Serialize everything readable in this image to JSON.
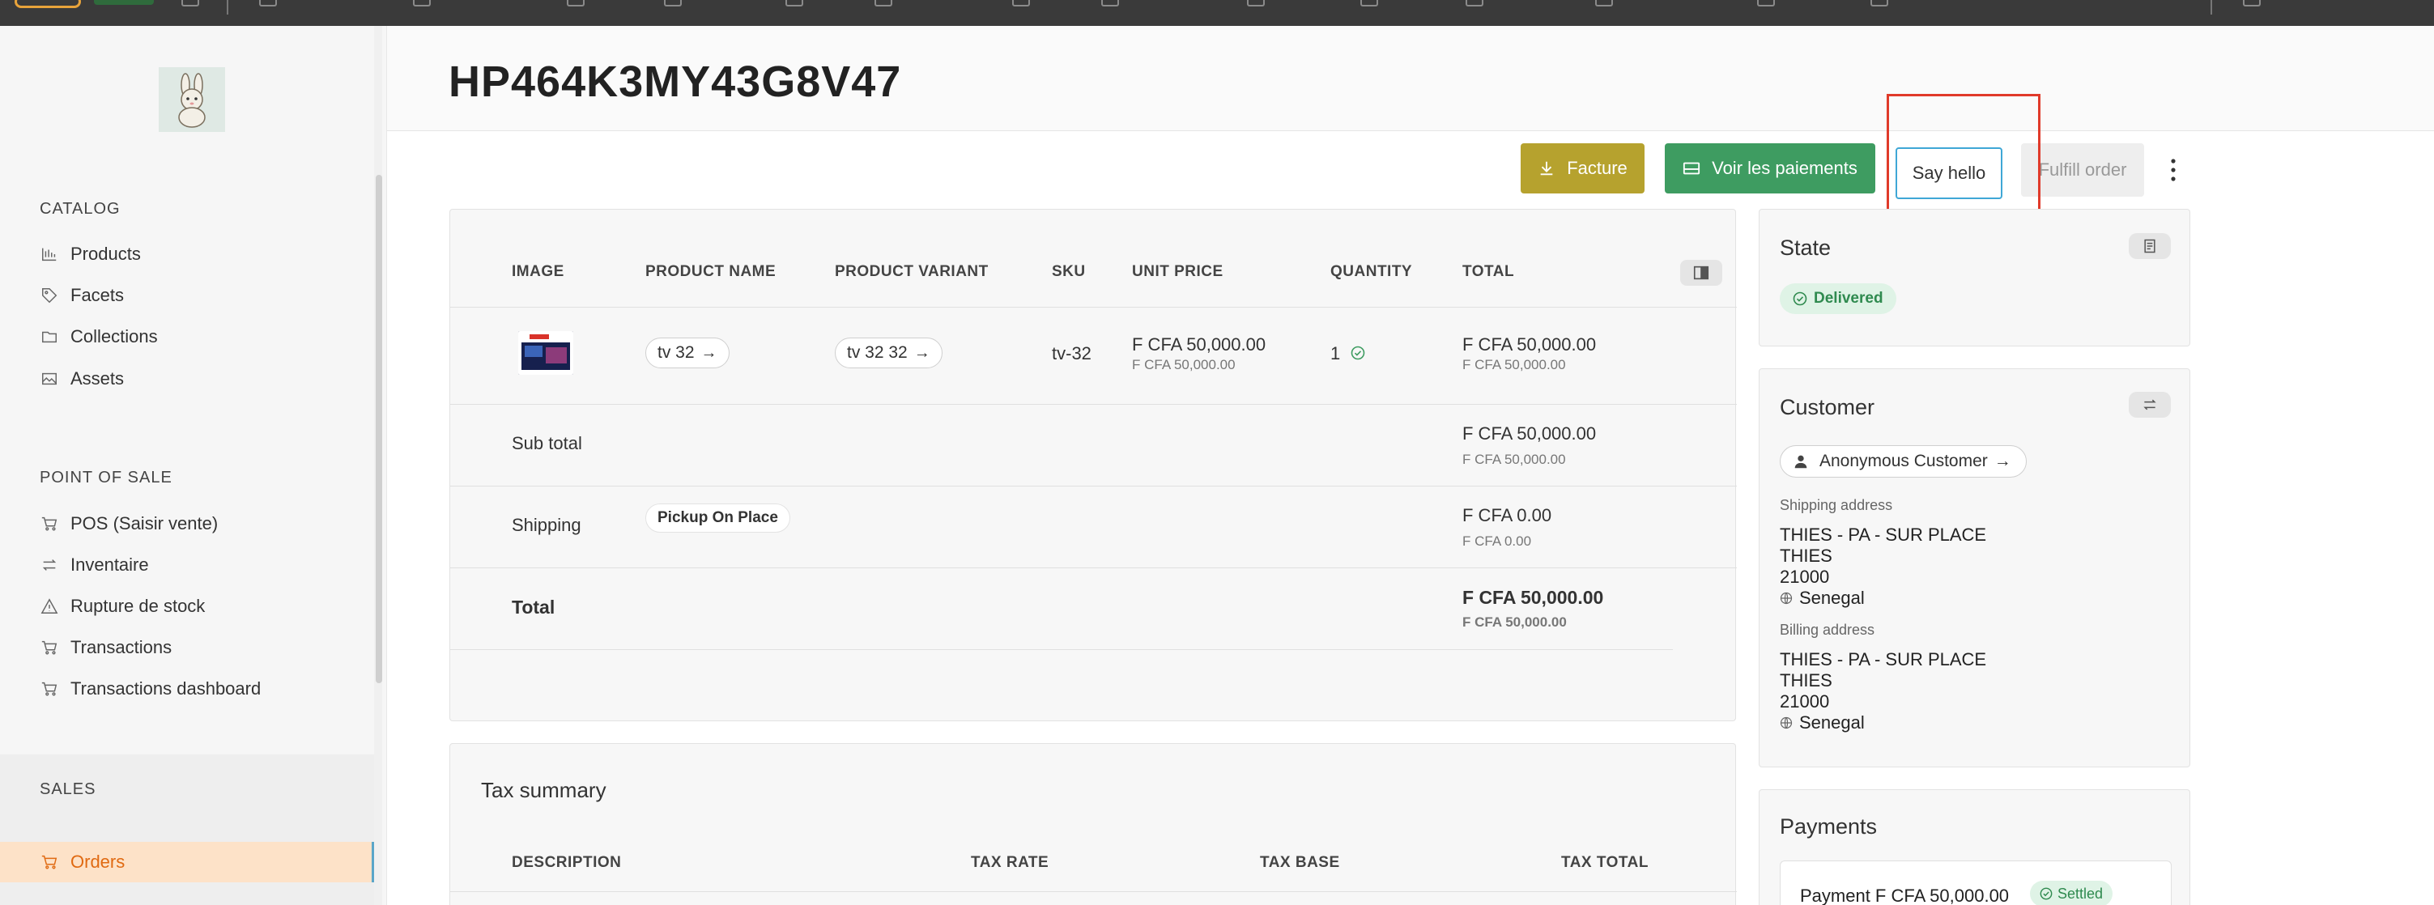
{
  "page": {
    "title": "HP464K3MY43G8V47"
  },
  "sidebar": {
    "sections": [
      {
        "title": "CATALOG",
        "items": [
          "Products",
          "Facets",
          "Collections",
          "Assets"
        ]
      },
      {
        "title": "POINT OF SALE",
        "items": [
          "POS (Saisir vente)",
          "Inventaire",
          "Rupture de stock",
          "Transactions",
          "Transactions dashboard"
        ]
      },
      {
        "title": "SALES",
        "items": [
          "Orders"
        ]
      }
    ]
  },
  "actions": {
    "facture": "Facture",
    "voir_paiements": "Voir les paiements",
    "say_hello": "Say hello",
    "fulfill": "Fulfill order"
  },
  "order_table": {
    "headers": [
      "IMAGE",
      "PRODUCT NAME",
      "PRODUCT VARIANT",
      "SKU",
      "UNIT PRICE",
      "QUANTITY",
      "TOTAL"
    ],
    "line": {
      "product_name": "tv 32",
      "variant": "tv 32 32",
      "sku": "tv-32",
      "unit_price": "F CFA 50,000.00",
      "unit_price_sub": "F CFA 50,000.00",
      "quantity": "1",
      "total": "F CFA 50,000.00",
      "total_sub": "F CFA 50,000.00"
    },
    "subtotal": {
      "label": "Sub total",
      "value": "F CFA 50,000.00",
      "sub": "F CFA 50,000.00"
    },
    "shipping": {
      "label": "Shipping",
      "method": "Pickup On Place",
      "value": "F CFA 0.00",
      "sub": "F CFA 0.00"
    },
    "total": {
      "label": "Total",
      "value": "F CFA 50,000.00",
      "sub": "F CFA 50,000.00"
    }
  },
  "tax": {
    "title": "Tax summary",
    "headers": [
      "DESCRIPTION",
      "TAX RATE",
      "TAX BASE",
      "TAX TOTAL"
    ]
  },
  "state": {
    "title": "State",
    "status": "Delivered"
  },
  "customer": {
    "title": "Customer",
    "name": "Anonymous Customer",
    "shipping_label": "Shipping address",
    "shipping": [
      "THIES - PA - SUR PLACE",
      "THIES",
      "21000",
      "Senegal"
    ],
    "billing_label": "Billing address",
    "billing": [
      "THIES - PA - SUR PLACE",
      "THIES",
      "21000",
      "Senegal"
    ]
  },
  "payments": {
    "title": "Payments",
    "entry": "Payment F CFA 50,000.00",
    "status": "Settled"
  },
  "colors": {
    "accent": "#e06a12",
    "facture": "#b6a22e",
    "paiements": "#3e9c61",
    "highlight": "#e03a2a"
  }
}
